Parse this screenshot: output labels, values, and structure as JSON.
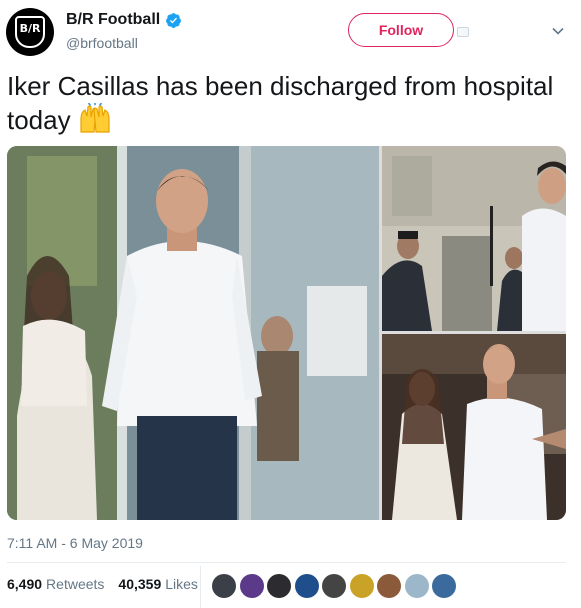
{
  "header": {
    "display_name": "B/R Football",
    "handle": "@brfootball",
    "avatar_text": "B/R",
    "follow_label": "Follow"
  },
  "tweet": {
    "text": "Iker Casillas has been discharged from hospital today",
    "emoji": "raising-hands-emoji"
  },
  "meta": {
    "timestamp": "7:11 AM - 6 May 2019"
  },
  "stats": {
    "retweets_count": "6,490",
    "retweets_label": "Retweets",
    "likes_count": "40,359",
    "likes_label": "Likes"
  },
  "likers": [
    {
      "name": "liker-avatar-1",
      "color": "#3b3f48"
    },
    {
      "name": "liker-avatar-2",
      "color": "#5b3a8a"
    },
    {
      "name": "liker-avatar-3",
      "color": "#2c2c30"
    },
    {
      "name": "liker-avatar-4",
      "color": "#1f4e8c"
    },
    {
      "name": "liker-avatar-5",
      "color": "#444444"
    },
    {
      "name": "liker-avatar-6",
      "color": "#c9a227"
    },
    {
      "name": "liker-avatar-7",
      "color": "#8a5a3b"
    },
    {
      "name": "liker-avatar-8",
      "color": "#9bb7c9"
    },
    {
      "name": "liker-avatar-9",
      "color": "#3a6b9c"
    }
  ],
  "colors": {
    "accent": "#e0245e",
    "verified": "#1da1f2",
    "secondary_text": "#657786",
    "primary_text": "#14171a"
  }
}
